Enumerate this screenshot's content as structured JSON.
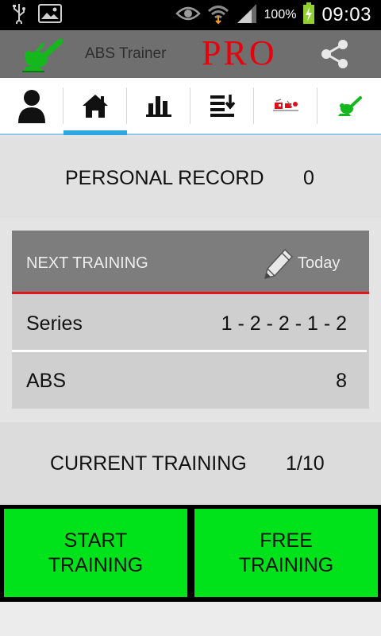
{
  "status_bar": {
    "battery_percent": "100%",
    "time": "09:03",
    "icons": [
      "usb-icon",
      "image-icon",
      "eye-icon",
      "wifi-icon",
      "signal-icon",
      "battery-charging-icon"
    ]
  },
  "app_bar": {
    "title": "ABS Trainer",
    "pro_label": "PRO",
    "share_icon": "share-icon"
  },
  "tabs": [
    {
      "name": "profile",
      "icon": "person-icon",
      "active": false
    },
    {
      "name": "home",
      "icon": "home-icon",
      "active": true
    },
    {
      "name": "stats",
      "icon": "bar-chart-icon",
      "active": false
    },
    {
      "name": "levels",
      "icon": "sort-list-icon",
      "active": false
    },
    {
      "name": "exercises",
      "icon": "exercise-figure-icon",
      "active": false
    },
    {
      "name": "abs",
      "icon": "situp-figure-icon",
      "active": false
    }
  ],
  "personal_record": {
    "label": "PERSONAL RECORD",
    "value": "0"
  },
  "next_training": {
    "header_label": "NEXT TRAINING",
    "date": "Today",
    "series_label": "Series",
    "series_value": "1 - 2 - 2 - 1 - 2",
    "abs_label": "ABS",
    "abs_value": "8"
  },
  "current_training": {
    "label": "CURRENT TRAINING",
    "value": "1/10"
  },
  "buttons": {
    "start": "START\nTRAINING",
    "free": "FREE\nTRAINING"
  },
  "colors": {
    "accent_green": "#00e31a",
    "pro_red": "#e8000a",
    "tab_indicator": "#2ea7de",
    "header_underline": "#e1151b"
  }
}
